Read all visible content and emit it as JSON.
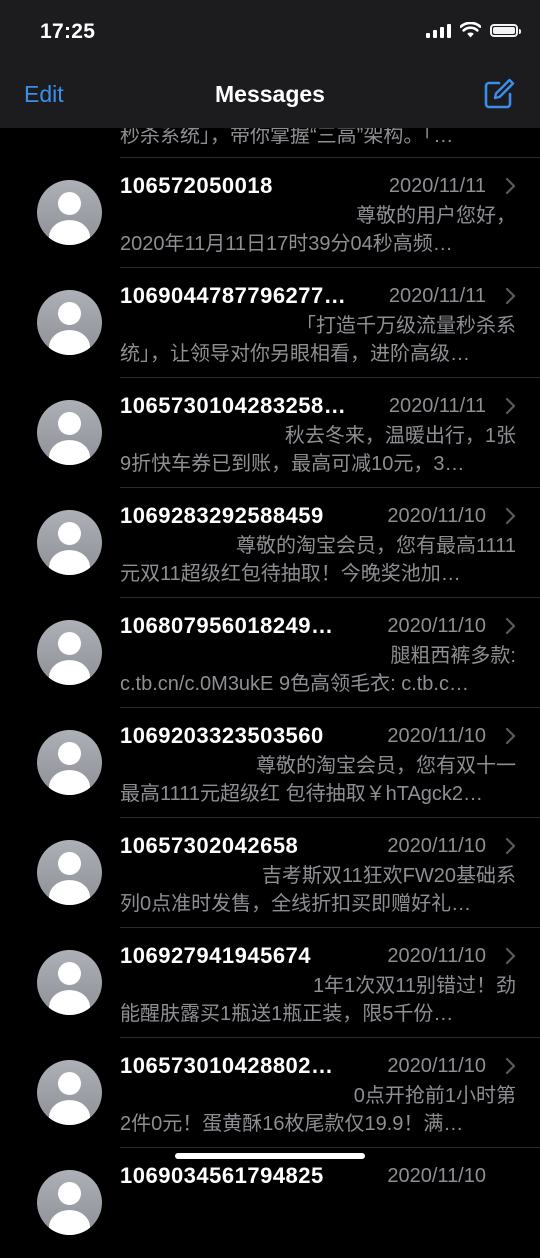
{
  "status": {
    "time": "17:25"
  },
  "nav": {
    "edit_label": "Edit",
    "title": "Messages"
  },
  "partial_top": {
    "text": "秒杀系统」，带你掌握“三高”架构。「…"
  },
  "conversations": [
    {
      "sender": "106572050018",
      "date": "2020/11/11",
      "line1": "尊敬的用户您好，",
      "line2": "2020年11月11日17时39分04秒高频…"
    },
    {
      "sender": "1069044787796277…",
      "date": "2020/11/11",
      "line1": "「打造千万级流量秒杀系",
      "line2": "统」，让领导对你另眼相看，进阶高级…"
    },
    {
      "sender": "1065730104283258…",
      "date": "2020/11/11",
      "line1": "秋去冬来，温暖出行，1张",
      "line2": "9折快车券已到账，最高可减10元，3…"
    },
    {
      "sender": "1069283292588459",
      "date": "2020/11/10",
      "line1": "尊敬的淘宝会员，您有最高1111",
      "line2": "元双11超级红包待抽取！今晚奖池加…"
    },
    {
      "sender": "106807956018249…",
      "date": "2020/11/10",
      "line1": "腿粗西裤多款:",
      "line2": "c.tb.cn/c.0M3ukE 9色高领毛衣: c.tb.c…"
    },
    {
      "sender": "1069203323503560",
      "date": "2020/11/10",
      "line1": "尊敬的淘宝会员，您有双十一",
      "line2": "最高1111元超级红 包待抽取￥hTAgck2…"
    },
    {
      "sender": "10657302042658",
      "date": "2020/11/10",
      "line1": "吉考斯双11狂欢FW20基础系",
      "line2": "列0点准时发售，全线折扣买即赠好礼…"
    },
    {
      "sender": "106927941945674",
      "date": "2020/11/10",
      "line1": "1年1次双11别错过！劲",
      "line2": "能醒肤露买1瓶送1瓶正装，限5千份…"
    },
    {
      "sender": "106573010428802…",
      "date": "2020/11/10",
      "line1": "0点开抢前1小时第",
      "line2": "2件0元！蛋黄酥16枚尾款仅19.9！满…"
    }
  ],
  "partial_bottom": {
    "sender": "1069034561794825",
    "date": "2020/11/10"
  }
}
